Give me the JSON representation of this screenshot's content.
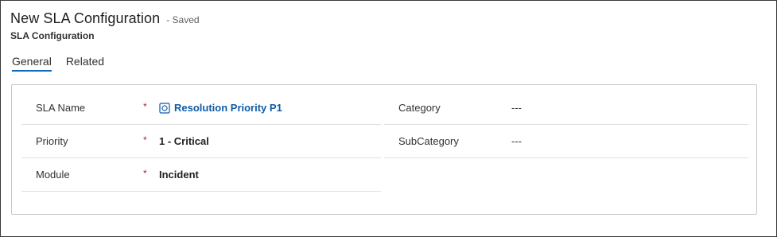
{
  "header": {
    "title": "New SLA Configuration",
    "saved_status": "- Saved",
    "subtitle": "SLA Configuration"
  },
  "tabs": [
    {
      "label": "General",
      "active": true
    },
    {
      "label": "Related",
      "active": false
    }
  ],
  "form": {
    "left": [
      {
        "label": "SLA Name",
        "required_mark": "*",
        "value": "Resolution Priority P1",
        "value_type": "lookup",
        "icon": "lookup-record-icon"
      },
      {
        "label": "Priority",
        "required_mark": "*",
        "value": "1 - Critical"
      },
      {
        "label": "Module",
        "required_mark": "*",
        "value": "Incident"
      }
    ],
    "right": [
      {
        "label": "Category",
        "value": "---"
      },
      {
        "label": "SubCategory",
        "value": "---"
      }
    ]
  },
  "colors": {
    "accent": "#0f6cbd",
    "link": "#0f5ba7",
    "required": "#a4262c",
    "border": "#c8c6c4"
  }
}
